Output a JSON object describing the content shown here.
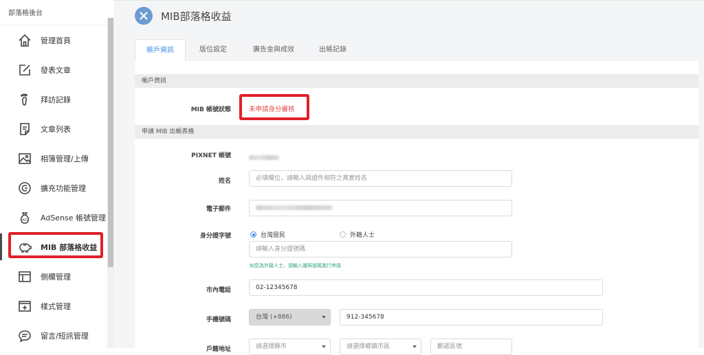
{
  "sidebar": {
    "title": "部落格後台",
    "items": [
      {
        "label": "管理首頁",
        "icon": "home-icon"
      },
      {
        "label": "發表文章",
        "icon": "edit-icon"
      },
      {
        "label": "拜訪記錄",
        "icon": "footprint-icon"
      },
      {
        "label": "文章列表",
        "icon": "document-list-icon"
      },
      {
        "label": "相簿管理/上傳",
        "icon": "image-icon"
      },
      {
        "label": "擴充功能管理",
        "icon": "extension-icon"
      },
      {
        "label": "AdSense 帳號管理",
        "icon": "ad-bag-icon"
      },
      {
        "label": "MIB 部落格收益",
        "icon": "piggy-bank-icon",
        "active": true
      },
      {
        "label": "側欄管理",
        "icon": "layout-icon"
      },
      {
        "label": "樣式管理",
        "icon": "style-add-icon"
      },
      {
        "label": "留言/短訊管理",
        "icon": "chat-icon"
      }
    ]
  },
  "header": {
    "title": "MIB部落格收益",
    "close_icon": "close-icon"
  },
  "tabs": [
    "帳戶資訊",
    "版位設定",
    "廣告金與成效",
    "出帳記錄"
  ],
  "active_tab": "帳戶資訊",
  "sections": {
    "account": "帳戶資訊",
    "application": "申請 MIB 出帳表格"
  },
  "account": {
    "status_label": "MIB 帳號狀態",
    "status_value": "未申請身分審核"
  },
  "form": {
    "pixnet_label": "PIXNET 帳號",
    "name_label": "姓名",
    "name_placeholder": "必填欄位，請輸入與證件相符之真實姓名",
    "email_label": "電子郵件",
    "id_label": "身分證字號",
    "radio_local": "台灣居民",
    "radio_foreign": "外籍人士",
    "id_placeholder": "請輸入身分證號碼",
    "id_hint": "如您為外籍人士，請輸入護照號碼進行申請",
    "phone_label": "市內電話",
    "phone_value": "02-12345678",
    "mobile_label": "手機號碼",
    "mobile_country": "台灣 (+886)",
    "mobile_value": "912-345678",
    "address_label": "戶籍地址",
    "address_city": "請選擇縣市",
    "address_district": "請選擇鄉鎮市區",
    "address_zip": "郵遞區號"
  },
  "colors": {
    "accent": "#3a8ee6",
    "highlight": "#e0202a",
    "status_red": "#e54646",
    "close_circle": "#6c9bd0"
  }
}
